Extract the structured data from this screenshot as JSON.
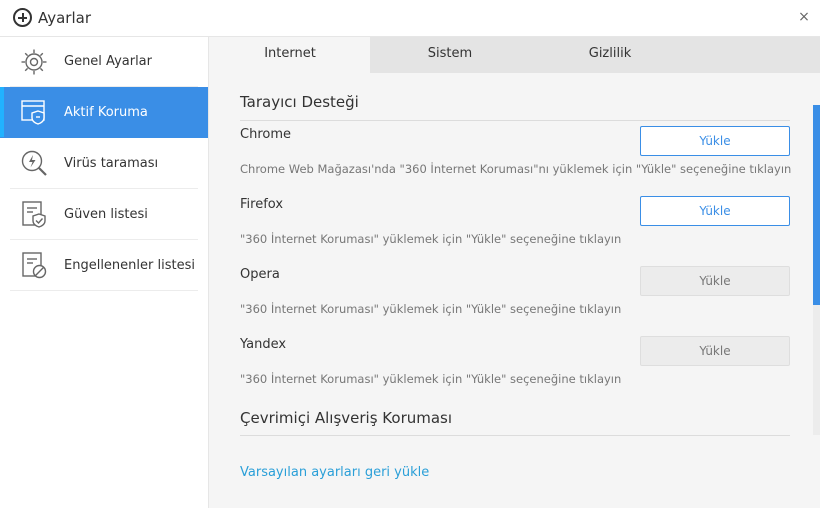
{
  "window": {
    "title": "Ayarlar",
    "close_symbol": "×"
  },
  "sidebar": {
    "items": [
      {
        "label": "Genel Ayarlar",
        "icon": "gear-icon"
      },
      {
        "label": "Aktif Koruma",
        "icon": "shield-window-icon",
        "active": true
      },
      {
        "label": "Virüs taraması",
        "icon": "scan-magnifier-icon"
      },
      {
        "label": "Güven listesi",
        "icon": "trust-list-icon"
      },
      {
        "label": "Engellenenler listesi",
        "icon": "blocked-list-icon"
      }
    ]
  },
  "tabs": [
    {
      "label": "Internet",
      "active": true
    },
    {
      "label": "Sistem"
    },
    {
      "label": "Gizlilik"
    }
  ],
  "browser_support": {
    "title": "Tarayıcı Desteği",
    "browsers": [
      {
        "name": "Chrome",
        "button": "Yükle",
        "enabled": true,
        "hint": "Chrome Web Mağazası'nda \"360 İnternet Koruması\"nı yüklemek için \"Yükle\" seçeneğine tıklayın"
      },
      {
        "name": "Firefox",
        "button": "Yükle",
        "enabled": true,
        "hint": "\"360 İnternet Koruması\" yüklemek için \"Yükle\" seçeneğine tıklayın"
      },
      {
        "name": "Opera",
        "button": "Yükle",
        "enabled": false,
        "hint": "\"360 İnternet Koruması\" yüklemek için \"Yükle\" seçeneğine tıklayın"
      },
      {
        "name": "Yandex",
        "button": "Yükle",
        "enabled": false,
        "hint": "\"360 İnternet Koruması\" yüklemek için \"Yükle\" seçeneğine tıklayın"
      }
    ]
  },
  "shopping": {
    "title": "Çevrimiçi Alışveriş Koruması"
  },
  "reset_link": "Varsayılan ayarları geri yükle",
  "colors": {
    "accent": "#3a8ee6",
    "link": "#2a9fd8",
    "sidebar_active": "#3a8ee6"
  }
}
